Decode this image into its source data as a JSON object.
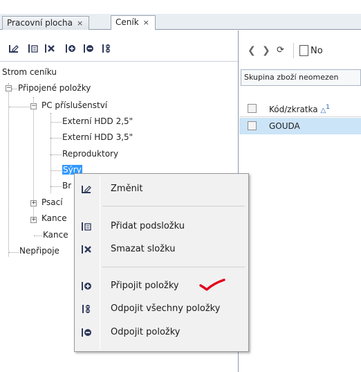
{
  "tabs": [
    {
      "label": "Pracovní plocha",
      "close": "×"
    },
    {
      "label": "Ceník",
      "close": "×"
    }
  ],
  "tree": {
    "root": "Strom ceníku",
    "nodes": {
      "pripojene": "Připojené položky",
      "pc": "PC příslušenství",
      "hdd25": "Externí HDD 2,5\"",
      "hdd35": "Externí HDD 3,5\"",
      "repro": "Reproduktory",
      "syry": "Sýry",
      "br": "Br",
      "psaci": "Psací",
      "kance1": "Kance",
      "kance2": "Kance",
      "nepripoj": "Nepřipoje"
    }
  },
  "context_menu": {
    "items": [
      {
        "label": "Změnit",
        "icon": "edit-icon"
      },
      {
        "label": "Přidat podsložku",
        "icon": "add-subfolder-icon"
      },
      {
        "label": "Smazat složku",
        "icon": "delete-folder-icon"
      },
      {
        "label": "Připojit položky",
        "icon": "attach-items-icon"
      },
      {
        "label": "Odpojit všechny položky",
        "icon": "detach-all-icon"
      },
      {
        "label": "Odpojit položky",
        "icon": "detach-items-icon"
      }
    ]
  },
  "right": {
    "new_label": "No",
    "filter_text": "Skupina zboží neomezen",
    "column_header": "Kód/zkratka",
    "sort_index": "1",
    "row_value": "GOUDA"
  },
  "colors": {
    "selection": "#3399ff",
    "checkmark": "#e2001a",
    "icon": "#2f3a5a"
  }
}
